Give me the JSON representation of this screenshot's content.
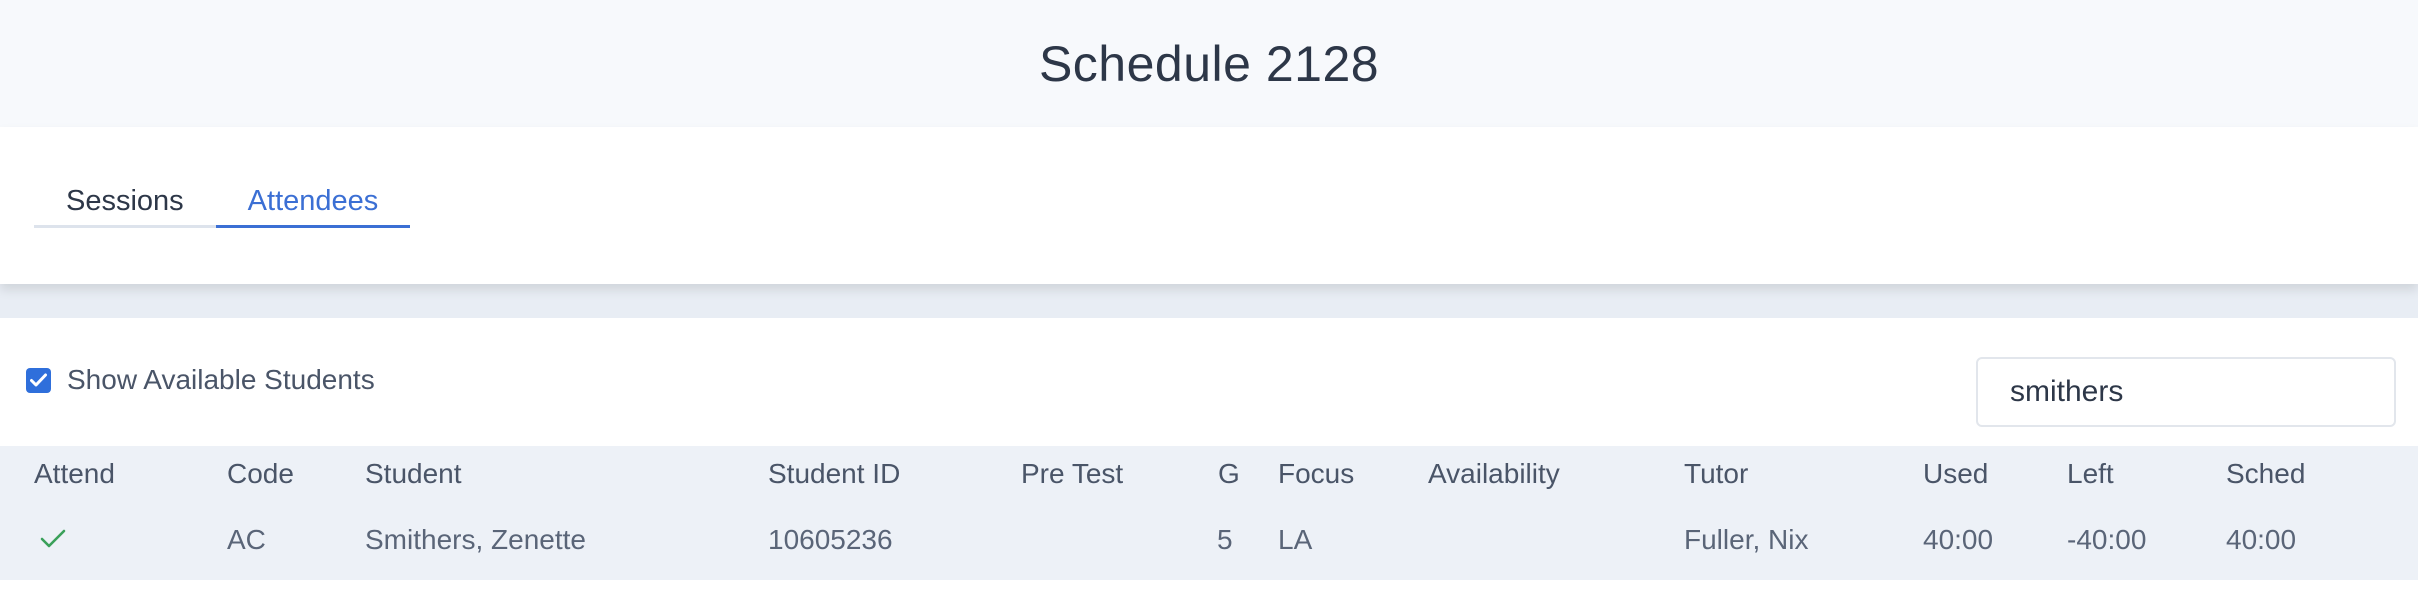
{
  "page": {
    "title": "Schedule 2128"
  },
  "tabs": [
    {
      "label": "Sessions",
      "active": false
    },
    {
      "label": "Attendees",
      "active": true
    }
  ],
  "filters": {
    "show_available_label": "Show Available Students",
    "show_available_checked": true,
    "search_value": "smithers"
  },
  "table": {
    "columns": [
      "Attend",
      "Code",
      "Student",
      "Student ID",
      "Pre Test",
      "G",
      "Focus",
      "Availability",
      "Tutor",
      "Used",
      "Left",
      "Sched"
    ],
    "rows": [
      {
        "attend": "check-icon",
        "code": "AC",
        "student": "Smithers, Zenette",
        "student_id": "10605236",
        "pre_test": "",
        "g": "5",
        "focus": "LA",
        "availability": "",
        "tutor": "Fuller, Nix",
        "used": "40:00",
        "left": "-40:00",
        "sched": "40:00"
      }
    ]
  },
  "colors": {
    "accent": "#3b6fd4",
    "checkbox": "#2f6fdb",
    "check_icon": "#3aa05a",
    "header_bg": "#f7f9fc",
    "table_bg": "#edf1f7"
  }
}
